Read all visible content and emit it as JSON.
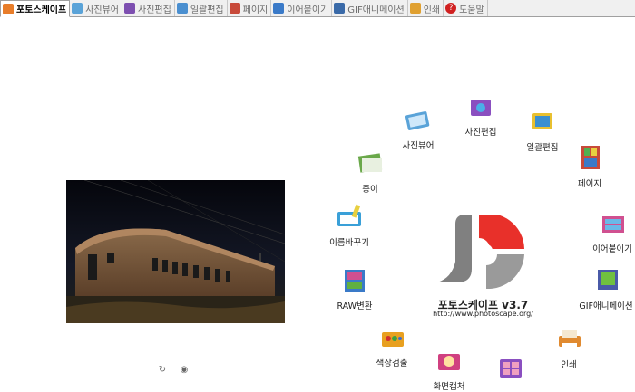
{
  "tabs": [
    {
      "label": "포토스케이프",
      "active": true,
      "color": "#e87d2a"
    },
    {
      "label": "사진뷰어",
      "active": false,
      "color": "#5aa3d8"
    },
    {
      "label": "사진편집",
      "active": false,
      "color": "#7d4fb0"
    },
    {
      "label": "일괄편집",
      "active": false,
      "color": "#4a8fd0"
    },
    {
      "label": "페이지",
      "active": false,
      "color": "#c84a3a"
    },
    {
      "label": "이어붙이기",
      "active": false,
      "color": "#3a7ac8"
    },
    {
      "label": "GIF애니메이션",
      "active": false,
      "color": "#3a6aa8"
    },
    {
      "label": "인쇄",
      "active": false,
      "color": "#e0a030"
    },
    {
      "label": "도움말",
      "active": false,
      "color": "#d02020"
    }
  ],
  "launcher": {
    "app_name": "포토스케이프 v3.7",
    "url": "http://www.photoscape.org/",
    "items": [
      {
        "label": "사진뷰어",
        "icon": "photo-viewer-icon",
        "color": "#5aa3d8"
      },
      {
        "label": "사진편집",
        "icon": "photo-editor-icon",
        "color": "#8a4fc0"
      },
      {
        "label": "일괄편집",
        "icon": "batch-editor-icon",
        "color": "#3a8fd0"
      },
      {
        "label": "페이지",
        "icon": "page-icon",
        "color": "#c84a3a"
      },
      {
        "label": "이어붙이기",
        "icon": "combine-icon",
        "color": "#d05090"
      },
      {
        "label": "GIF애니메이션",
        "icon": "gif-animation-icon",
        "color": "#4a5aa8"
      },
      {
        "label": "인쇄",
        "icon": "print-icon",
        "color": "#e08a30"
      },
      {
        "label": "종이",
        "icon": "paper-icon",
        "color": "#6aa84a"
      },
      {
        "label": "이름바꾸기",
        "icon": "rename-icon",
        "color": "#3aa0d8"
      },
      {
        "label": "RAW변환",
        "icon": "raw-convert-icon",
        "color": "#3a7ac8"
      },
      {
        "label": "색상검출",
        "icon": "color-picker-icon",
        "color": "#e8a020"
      },
      {
        "label": "화면캡처",
        "icon": "screen-capture-icon",
        "color": "#d04080"
      },
      {
        "label": "",
        "icon": "split-icon",
        "color": "#8a4fc0"
      }
    ]
  },
  "preview": {
    "image": "old-train-car-at-night-image"
  },
  "tools": [
    {
      "icon": "rotate-icon",
      "glyph": "↻"
    },
    {
      "icon": "eye-icon",
      "glyph": "◉"
    }
  ]
}
